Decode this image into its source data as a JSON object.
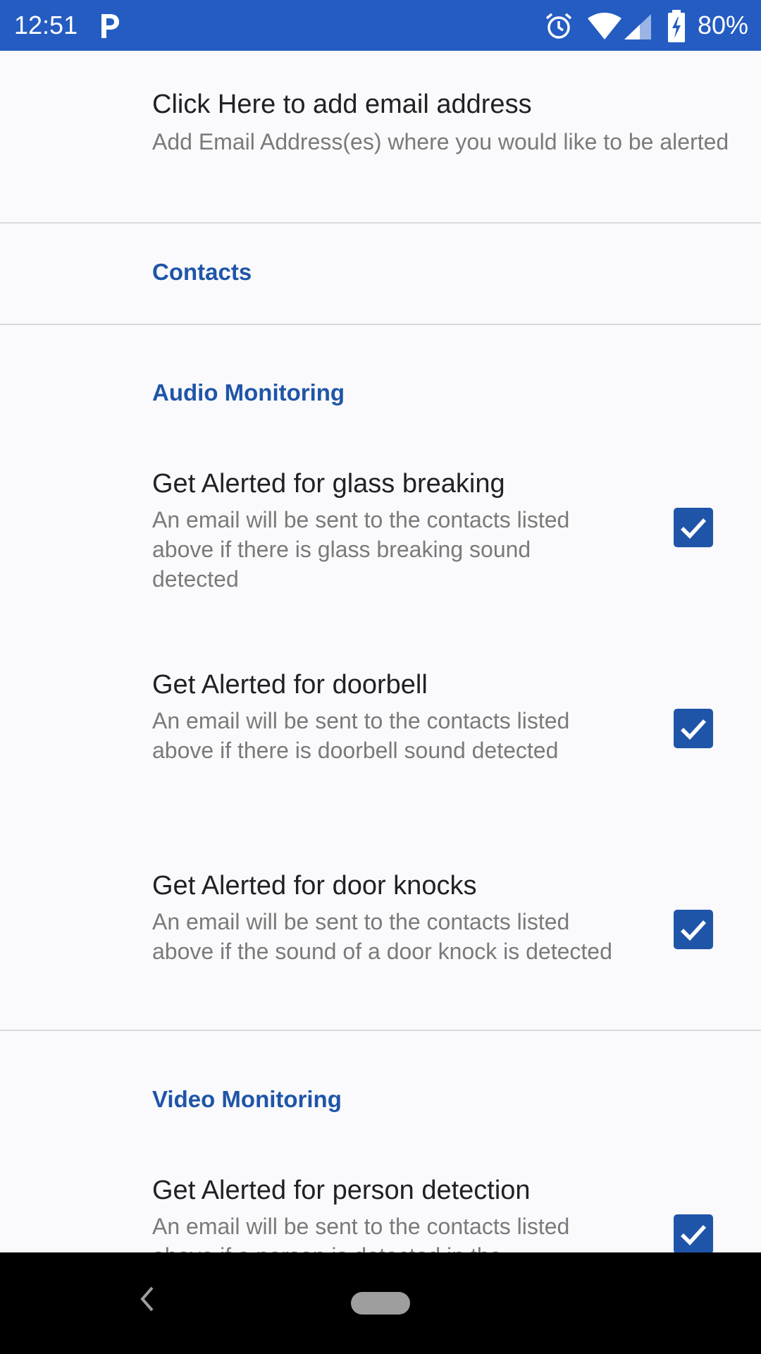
{
  "status_bar": {
    "time": "12:51",
    "battery_percent": "80%",
    "background_color": "#245cc2",
    "icons": [
      "parking-app-icon",
      "alarm-icon",
      "wifi-icon",
      "cell-signal-icon",
      "battery-charging-icon"
    ]
  },
  "email": {
    "title": "Click Here to add email address",
    "summary": "Add Email Address(es) where you would like to be alerted"
  },
  "contacts": {
    "label": "Contacts"
  },
  "audio_monitoring": {
    "label": "Audio Monitoring",
    "items": [
      {
        "title": "Get Alerted for glass breaking",
        "summary": "An email will be sent to the contacts listed above if there is glass breaking sound detected",
        "checked": true
      },
      {
        "title": "Get Alerted for doorbell",
        "summary": "An email will be sent to the contacts listed above if there is doorbell sound detected",
        "checked": true
      },
      {
        "title": "Get Alerted for door knocks",
        "summary": "An email will be sent to the contacts listed above if the sound of a door knock is detected",
        "checked": true
      }
    ]
  },
  "video_monitoring": {
    "label": "Video Monitoring",
    "items": [
      {
        "title": "Get Alerted for person detection",
        "summary": "An email will be sent to the contacts listed above if a person is detected in the",
        "checked": true
      }
    ]
  },
  "accent_color": "#1f55a8",
  "nav_bar": {
    "icons": [
      "back-icon",
      "home-pill"
    ]
  }
}
